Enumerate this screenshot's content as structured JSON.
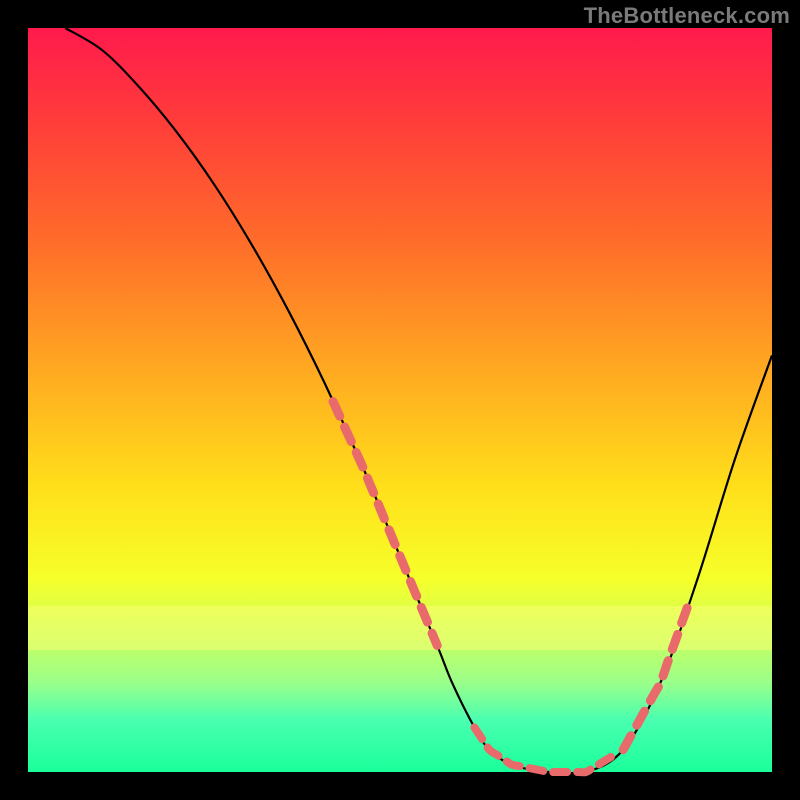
{
  "watermark": "TheBottleneck.com",
  "chart_data": {
    "type": "line",
    "title": "",
    "xlabel": "",
    "ylabel": "",
    "xlim": [
      0,
      100
    ],
    "ylim": [
      0,
      100
    ],
    "x": [
      5,
      10,
      15,
      20,
      25,
      30,
      35,
      40,
      45,
      50,
      55,
      57,
      60,
      62,
      65,
      70,
      75,
      80,
      85,
      90,
      95,
      100
    ],
    "values": [
      100,
      97,
      92,
      86,
      79,
      71,
      62,
      52,
      41,
      29,
      17,
      12,
      6,
      3,
      1,
      0,
      0,
      3,
      12,
      26,
      42,
      56
    ],
    "marker_segments": [
      {
        "x_start": 41,
        "x_end": 55
      },
      {
        "x_start": 80,
        "x_end": 89
      }
    ],
    "trough_marker_x_range": [
      60,
      79
    ],
    "gradient_stops": [
      {
        "pos": 0.0,
        "color": "#ff1a4d"
      },
      {
        "pos": 0.62,
        "color": "#ffe01a"
      },
      {
        "pos": 1.0,
        "color": "#1aff9a"
      }
    ]
  }
}
